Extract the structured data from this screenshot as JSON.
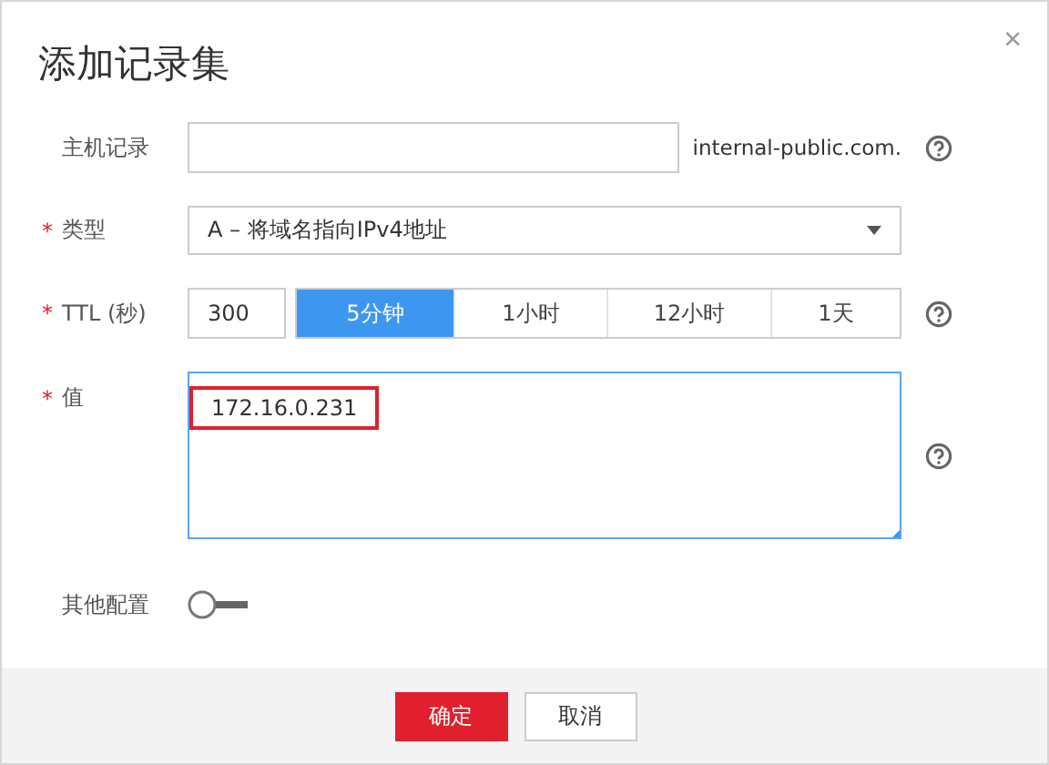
{
  "dialog": {
    "title": "添加记录集",
    "close": "×"
  },
  "fields": [
    {
      "kind": "text",
      "label": "主机记录",
      "suffix": "internal-public.com.",
      "help": true
    },
    {
      "kind": "select",
      "label": "类型",
      "required_mark": "*",
      "value": "A – 将域名指向IPv4地址"
    },
    {
      "kind": "ttl",
      "label": "TTL (秒)",
      "required_mark": "*",
      "value": "300",
      "options": [
        {
          "label": "5分钟",
          "selected": true
        },
        {
          "label": "1小时",
          "selected": false
        },
        {
          "label": "12小时",
          "selected": false
        },
        {
          "label": "1天",
          "selected": false
        }
      ],
      "help": true
    },
    {
      "kind": "textarea",
      "label": "值",
      "required_mark": "*",
      "value": "172.16.0.231",
      "highlighted": true,
      "help": true
    },
    {
      "kind": "toggle",
      "label": "其他配置",
      "on": false
    }
  ],
  "footer": {
    "buttons": [
      {
        "label": "确定",
        "kind": "primary"
      },
      {
        "label": "取消",
        "kind": "secondary"
      }
    ]
  }
}
